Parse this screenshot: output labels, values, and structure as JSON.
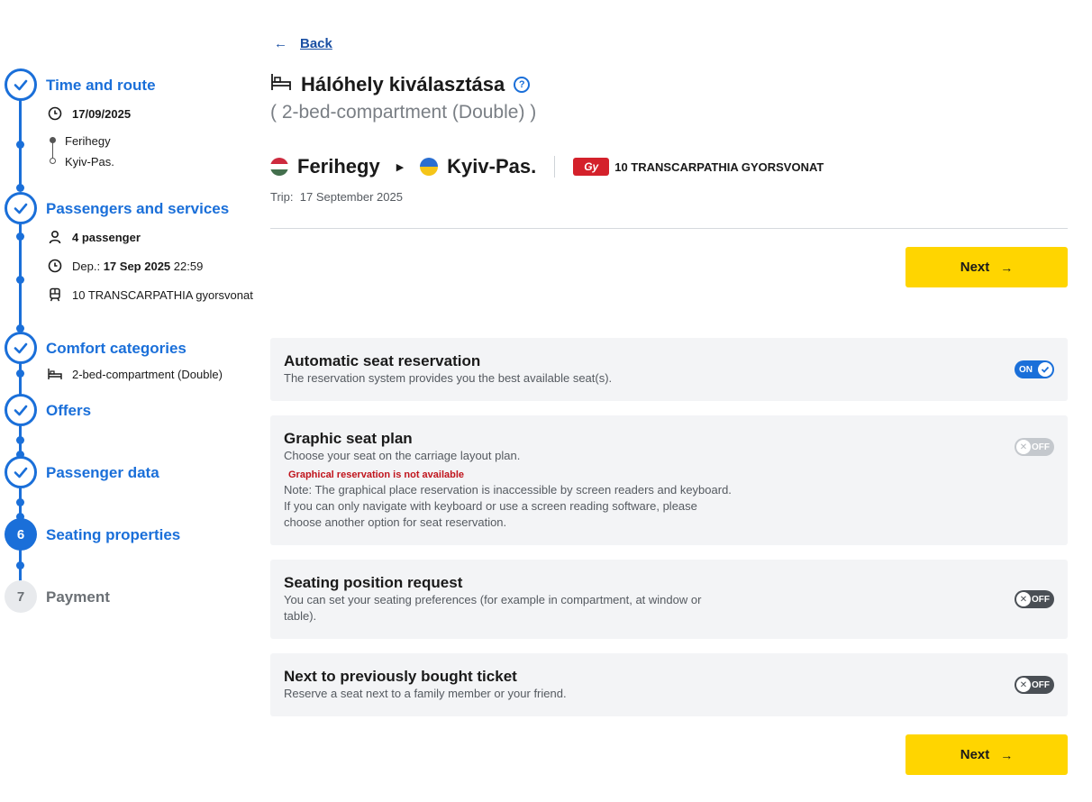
{
  "sidebar": {
    "steps": [
      {
        "number": "",
        "title": "Time and route",
        "state": "done"
      },
      {
        "number": "",
        "title": "Passengers and services",
        "state": "done"
      },
      {
        "number": "",
        "title": "Comfort categories",
        "state": "done"
      },
      {
        "number": "",
        "title": "Offers",
        "state": "done"
      },
      {
        "number": "",
        "title": "Passenger data",
        "state": "done"
      },
      {
        "number": "6",
        "title": "Seating properties",
        "state": "current"
      },
      {
        "number": "7",
        "title": "Payment",
        "state": "todo"
      }
    ],
    "time_route": {
      "date": "17/09/2025",
      "from": "Ferihegy",
      "to": "Kyiv-Pas."
    },
    "passengers": {
      "count": "4 passenger",
      "dep_label": "Dep.:",
      "dep_date": "17 Sep 2025",
      "dep_time": "22:59",
      "train": "10 TRANSCARPATHIA gyorsvonat"
    },
    "comfort": {
      "category": "2-bed-compartment (Double)"
    }
  },
  "main": {
    "back_label": "Back",
    "title": "Hálóhely kiválasztása",
    "help_glyph": "?",
    "subtitle": "( 2-bed-compartment (Double) )",
    "route": {
      "from": "Ferihegy",
      "to": "Kyiv-Pas.",
      "train_logo": "Gy",
      "train_name": "10 TRANSCARPATHIA GYORSVONAT"
    },
    "trip_label": "Trip:",
    "trip_date": "17 September 2025",
    "next_label": "Next",
    "options": [
      {
        "title": "Automatic seat reservation",
        "description": "The reservation system provides you the best available seat(s).",
        "toggle": "ON",
        "state": "on"
      },
      {
        "title": "Graphic seat plan",
        "description": "Choose your seat on the carriage layout plan.",
        "warning": "Graphical reservation is not available",
        "note": "Note: The graphical place reservation is inaccessible by screen readers and keyboard. If you can only navigate with keyboard or use a screen reading software, please choose another option for seat reservation.",
        "toggle": "OFF",
        "state": "disabled"
      },
      {
        "title": "Seating position request",
        "description": "You can set your seating preferences (for example in compartment, at window or table).",
        "toggle": "OFF",
        "state": "off"
      },
      {
        "title": "Next to previously bought ticket",
        "description": "Reserve a seat next to a family member or your friend.",
        "toggle": "OFF",
        "state": "off"
      }
    ]
  },
  "colors": {
    "accent": "#1a6fd9",
    "button": "#ffd500",
    "warning": "#c0141c",
    "card_bg": "#f3f4f6"
  }
}
